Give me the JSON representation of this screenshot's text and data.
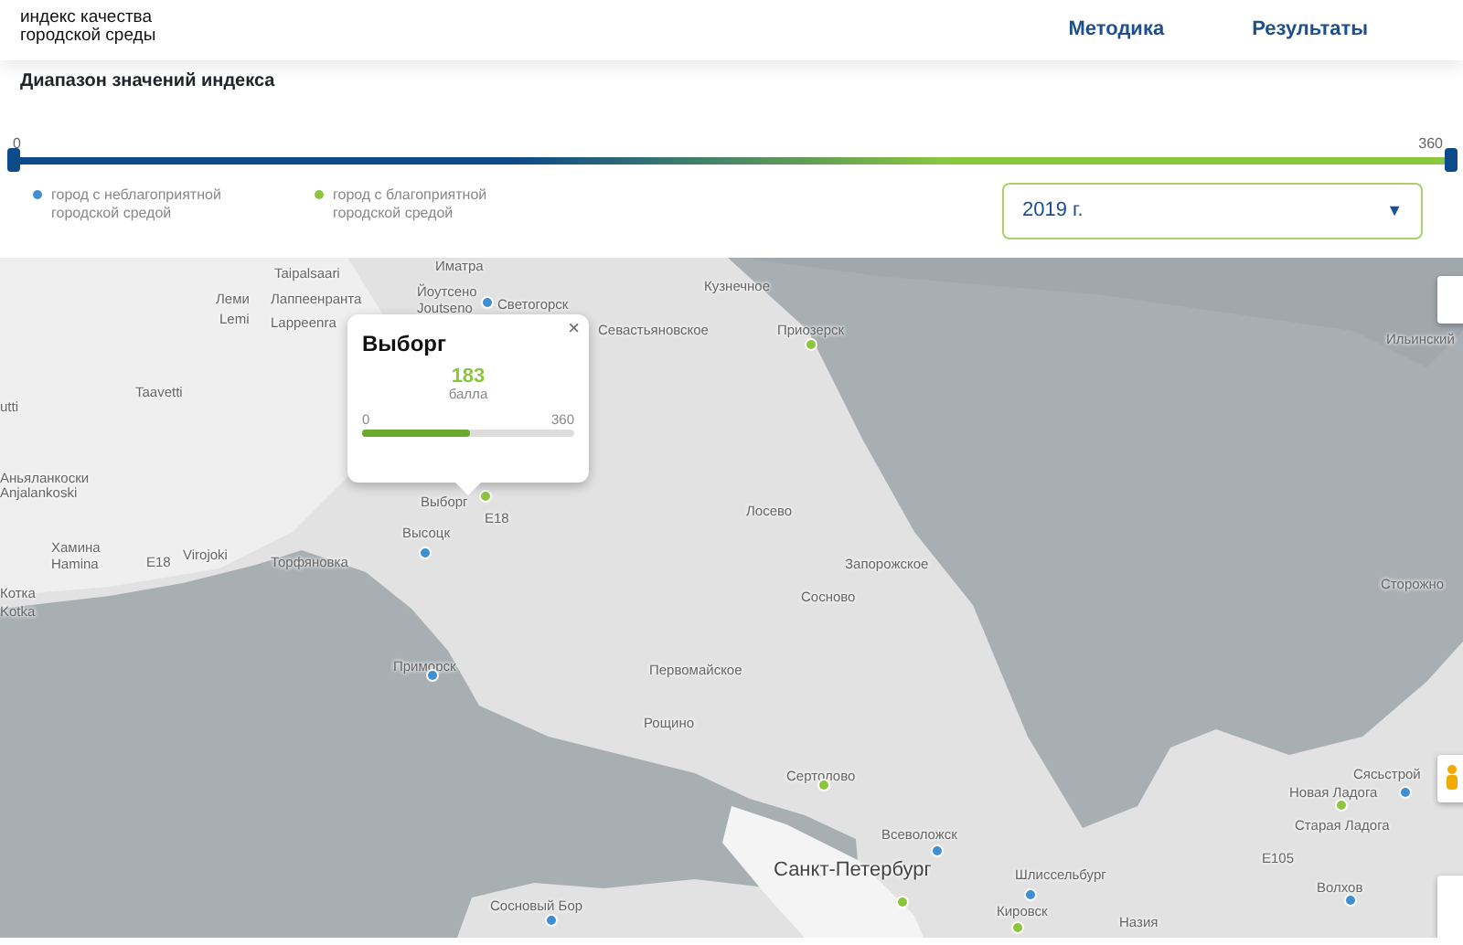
{
  "header": {
    "logo_lines": [
      "индекс качества",
      "городской среды"
    ],
    "nav": [
      {
        "label": "Методика"
      },
      {
        "label": "Результаты"
      }
    ]
  },
  "range": {
    "title": "Диапазон значений индекса",
    "min_label": "0",
    "max_label": "360",
    "handles": [
      {
        "level": 0
      },
      {
        "level": 1
      }
    ]
  },
  "legend": [
    {
      "label": "город с неблагоприятной городской средой",
      "color": "#3f8fd2"
    },
    {
      "label": "город с благоприятной городской средой",
      "color": "#8cc63f"
    }
  ],
  "year_select": {
    "value": "2019 г.",
    "caret": "▼"
  },
  "map": {
    "places": [
      {
        "label": "Иматра"
      },
      {
        "label": "Taipalsaari"
      },
      {
        "label": "Йоутсено"
      },
      {
        "label": "Joutseno"
      },
      {
        "label": "Светогорск",
        "color": "#3f8fd2"
      },
      {
        "label": "Леми"
      },
      {
        "label": "Lemi"
      },
      {
        "label": "Лаппеенранта"
      },
      {
        "label": "Lappeenra"
      },
      {
        "label": "Кузнечное"
      },
      {
        "label": "Севастьяновское"
      },
      {
        "label": "Приозерск",
        "color": "#8cc63f"
      },
      {
        "label": "Ильинский"
      },
      {
        "label": "Taavetti"
      },
      {
        "label": "utti"
      },
      {
        "label": "Аньяланкоски"
      },
      {
        "label": "Anjalankoski"
      },
      {
        "label": "Выборг",
        "color": "#8cc63f"
      },
      {
        "label": "E18"
      },
      {
        "label": "Высоцк",
        "color": "#3f8fd2"
      },
      {
        "label": "Лосево"
      },
      {
        "label": "Хамина"
      },
      {
        "label": "Hamina"
      },
      {
        "label": "E18"
      },
      {
        "label": "Virojoki"
      },
      {
        "label": "Торфяновка"
      },
      {
        "label": "Запорожское"
      },
      {
        "label": "Котка"
      },
      {
        "label": "Kotka"
      },
      {
        "label": "Сторожно"
      },
      {
        "label": "Сосново"
      },
      {
        "label": "Приморск",
        "color": "#3f8fd2"
      },
      {
        "label": "Первомайское"
      },
      {
        "label": "Рощино"
      },
      {
        "label": "Сясьстрой",
        "color": "#3f8fd2"
      },
      {
        "label": "Сертолово",
        "color": "#8cc63f"
      },
      {
        "label": "Новая Ладога",
        "color": "#8cc63f"
      },
      {
        "label": "Всеволожск",
        "color": "#3f8fd2"
      },
      {
        "label": "Старая Ладога"
      },
      {
        "label": "E105"
      },
      {
        "label": "Санкт-Петербург",
        "color": "#8cc63f"
      },
      {
        "label": "Шлиссельбург",
        "color": "#3f8fd2"
      },
      {
        "label": "Волхов",
        "color": "#3f8fd2"
      },
      {
        "label": "Сосновый Бор",
        "color": "#3f8fd2"
      },
      {
        "label": "Кировск",
        "color": "#8cc63f"
      },
      {
        "label": "Назия"
      }
    ],
    "popup": {
      "title": "Выборг",
      "score": "183",
      "unit": "балла",
      "min_label": "0",
      "max_label": "360",
      "level": 0.508,
      "close": "×"
    }
  }
}
